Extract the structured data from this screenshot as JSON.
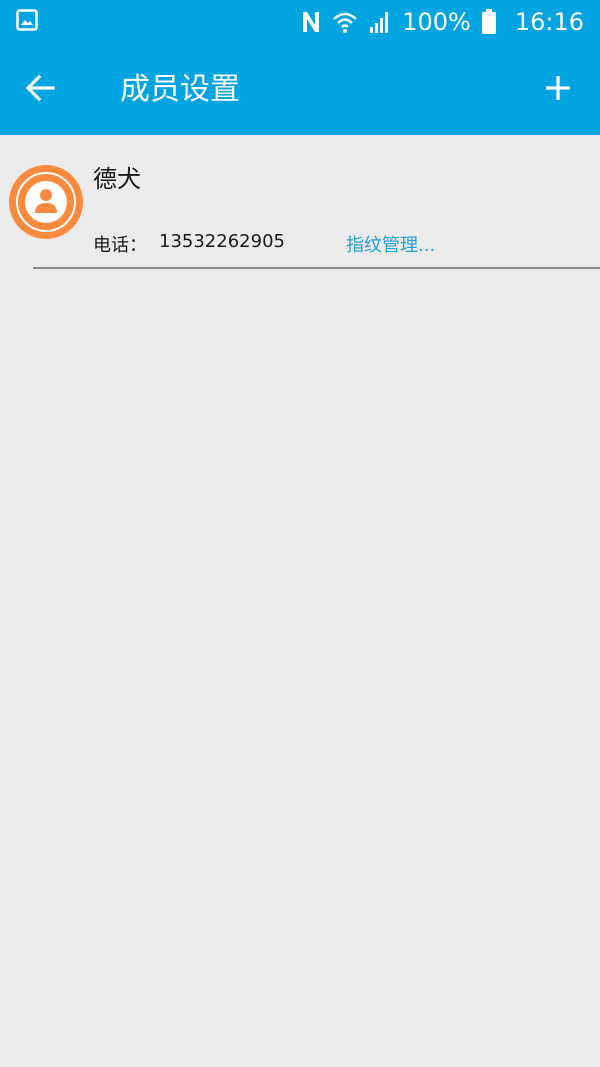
{
  "status_bar": {
    "battery_percent": "100%",
    "time": "16:16",
    "icons": [
      "gallery-icon",
      "nfc-icon",
      "wifi-icon",
      "signal-icon",
      "battery-icon"
    ]
  },
  "app_bar": {
    "title": "成员设置",
    "back_icon": "arrow-left-icon",
    "add_icon": "plus-icon"
  },
  "colors": {
    "primary": "#00a4e0",
    "background": "#ebebeb",
    "avatar_orange": "#fb8a3c",
    "link_blue": "#1e9fd8"
  },
  "members": [
    {
      "name": "德犬",
      "phone_label": "电话：",
      "phone": "13532262905",
      "fingerprint_link": "指纹管理..."
    }
  ]
}
